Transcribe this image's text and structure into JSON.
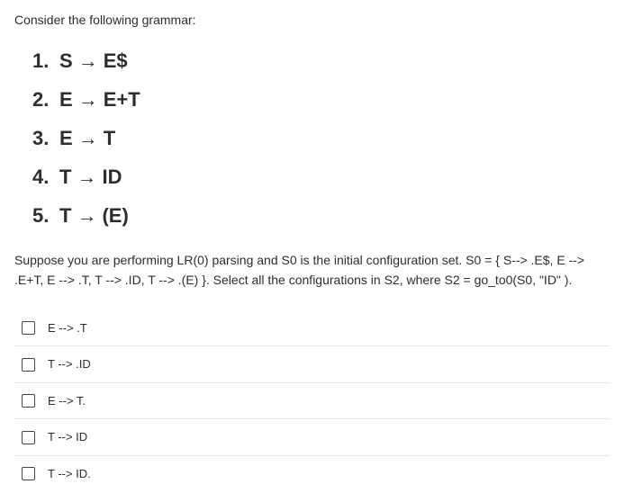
{
  "intro": "Consider the following grammar:",
  "grammar": [
    {
      "num": "1.",
      "lhs": "S",
      "rhs": "E$"
    },
    {
      "num": "2.",
      "lhs": "E",
      "rhs": "E+T"
    },
    {
      "num": "3.",
      "lhs": "E",
      "rhs": "T"
    },
    {
      "num": "4.",
      "lhs": "T",
      "rhs": "ID"
    },
    {
      "num": "5.",
      "lhs": "T",
      "rhs": "(E)"
    }
  ],
  "arrow": "→",
  "question": "Suppose you are performing LR(0) parsing and S0 is the initial configuration set. S0 = { S--> .E$, E --> .E+T, E --> .T, T --> .ID, T --> .(E) }. Select all the configurations in S2, where S2 = go_to0(S0, \"ID\" ).",
  "options": [
    "E --> .T",
    "T --> .ID",
    "E --> T.",
    "T --> ID",
    "T --> ID."
  ]
}
